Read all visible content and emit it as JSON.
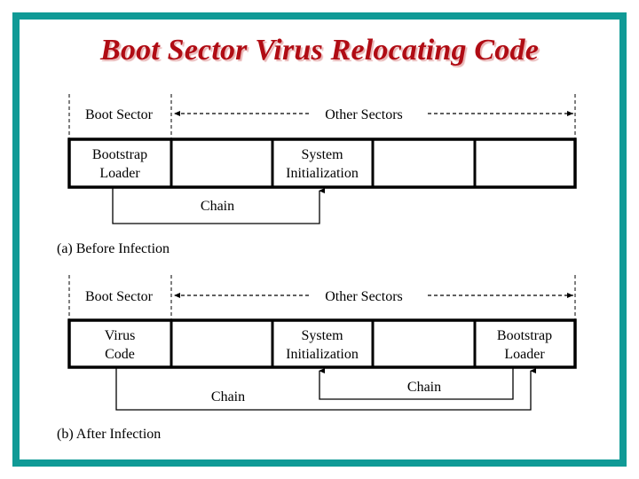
{
  "title": "Boot Sector Virus Relocating Code",
  "colors": {
    "frame": "#109a96",
    "title": "#b00c14",
    "lines": "#000000"
  },
  "diagram_a": {
    "caption": "(a) Before Infection",
    "boot_sector_label": "Boot Sector",
    "other_sectors_label": "Other Sectors",
    "cells": [
      {
        "line1": "Bootstrap",
        "line2": "Loader"
      },
      {
        "line1": "",
        "line2": ""
      },
      {
        "line1": "System",
        "line2": "Initialization"
      },
      {
        "line1": "",
        "line2": ""
      },
      {
        "line1": "",
        "line2": ""
      }
    ],
    "chains": [
      {
        "label": "Chain",
        "from": "Bootstrap Loader",
        "to": "System Initialization"
      }
    ]
  },
  "diagram_b": {
    "caption": "(b) After Infection",
    "boot_sector_label": "Boot Sector",
    "other_sectors_label": "Other Sectors",
    "cells": [
      {
        "line1": "Virus",
        "line2": "Code"
      },
      {
        "line1": "",
        "line2": ""
      },
      {
        "line1": "System",
        "line2": "Initialization"
      },
      {
        "line1": "",
        "line2": ""
      },
      {
        "line1": "Bootstrap",
        "line2": "Loader"
      }
    ],
    "chains": [
      {
        "label": "Chain",
        "from": "Virus Code",
        "to": "Bootstrap Loader"
      },
      {
        "label": "Chain",
        "from": "Bootstrap Loader",
        "to": "System Initialization"
      }
    ]
  }
}
